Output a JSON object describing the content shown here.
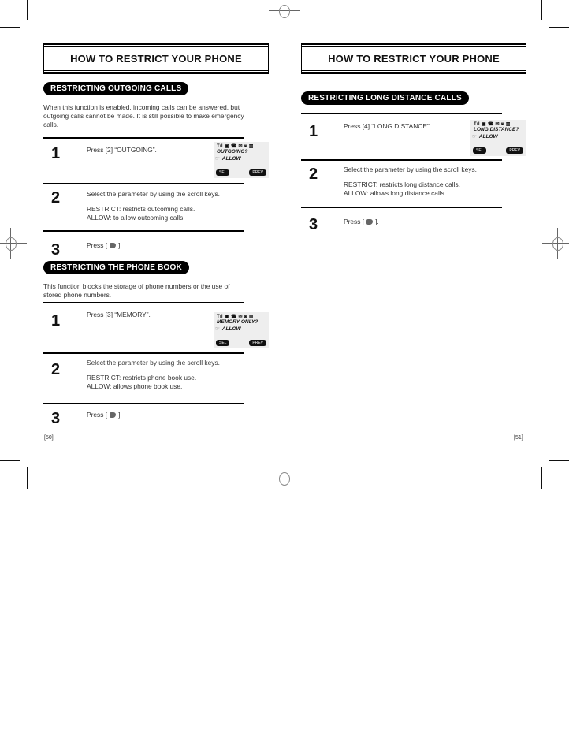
{
  "left_page": {
    "title": "HOW TO RESTRICT YOUR PHONE",
    "sections": [
      {
        "heading": "RESTRICTING OUTGOING CALLS",
        "intro": [
          "When this function is enabled, incoming calls can be answered, but",
          "outgoing calls cannot be made. It is still possible to make emergency",
          "calls."
        ],
        "steps": [
          {
            "number": "1",
            "lines": [
              "Press [2] “OUTGOING”."
            ]
          },
          {
            "number": "2",
            "lines": [
              "Select the parameter by using the scroll keys.",
              "RESTRICT:  restricts outcoming calls.",
              "ALLOW:  to allow outcoming calls."
            ]
          },
          {
            "number": "3",
            "press_prefix": "Press [",
            "press_suffix": "]."
          }
        ],
        "lcd": {
          "icons": "Tıl ▣ ☎   ✉ ◙ ▥",
          "prompt": "OUTGOING?",
          "value": "ALLOW",
          "left_soft": "SEL",
          "right_soft": "PREV"
        }
      },
      {
        "heading": "RESTRICTING THE PHONE BOOK",
        "intro": [
          "This function blocks the storage of phone numbers or the use of",
          "stored phone numbers."
        ],
        "steps": [
          {
            "number": "1",
            "lines": [
              "Press [3] “MEMORY”."
            ]
          },
          {
            "number": "2",
            "lines": [
              "Select the parameter by using the scroll keys.",
              "RESTRICT:  restricts phone book use.",
              "ALLOW:  allows phone book use."
            ]
          },
          {
            "number": "3",
            "press_prefix": "Press [",
            "press_suffix": "]."
          }
        ],
        "lcd": {
          "icons": "Tıl ▣ ☎   ✉ ◙ ▥",
          "prompt": "MEMORY ONLY?",
          "value": "ALLOW",
          "left_soft": "SEL",
          "right_soft": "PREV"
        }
      }
    ],
    "page_number": "[50]"
  },
  "right_page": {
    "title": "HOW TO RESTRICT YOUR PHONE",
    "sections": [
      {
        "heading": "RESTRICTING LONG DISTANCE CALLS",
        "steps": [
          {
            "number": "1",
            "lines": [
              "Press [4] “LONG DISTANCE”."
            ]
          },
          {
            "number": "2",
            "lines": [
              "Select the parameter by using the scroll keys.",
              "RESTRICT:  restricts long distance calls.",
              "ALLOW:  allows long distance calls."
            ]
          },
          {
            "number": "3",
            "press_prefix": "Press [",
            "press_suffix": "]."
          }
        ],
        "lcd": {
          "icons": "Tıl ▣ ☎   ✉ ◙ ▥",
          "prompt": "LONG DISTANCE?",
          "value": "ALLOW",
          "left_soft": "SEL",
          "right_soft": "PREV"
        }
      }
    ],
    "page_number": "[51]"
  },
  "icons": {
    "pointer": "☞",
    "send_key": "send-key-icon"
  }
}
